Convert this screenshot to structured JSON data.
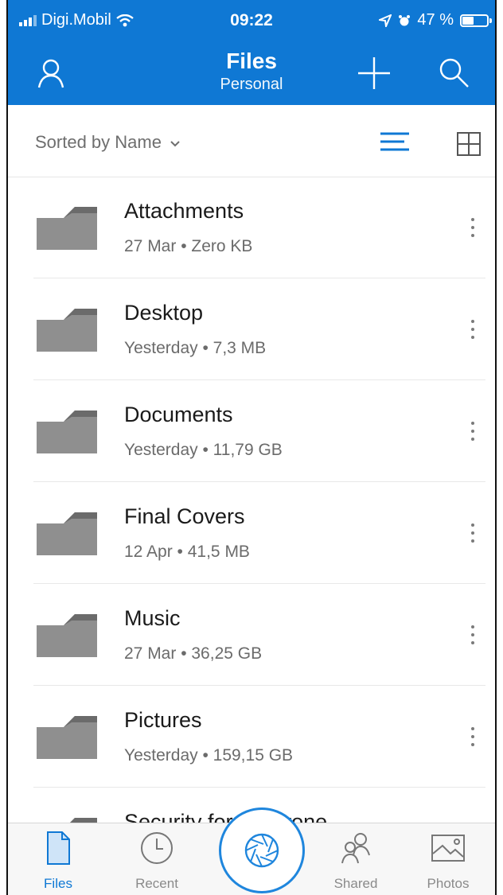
{
  "status_bar": {
    "carrier": "Digi.Mobil",
    "time": "09:22",
    "battery": "47 %"
  },
  "header": {
    "title": "Files",
    "subtitle": "Personal"
  },
  "sort": {
    "label": "Sorted by Name"
  },
  "items": [
    {
      "name": "Attachments",
      "meta": "27 Mar • Zero KB"
    },
    {
      "name": "Desktop",
      "meta": "Yesterday • 7,3 MB"
    },
    {
      "name": "Documents",
      "meta": "Yesterday • 11,79 GB"
    },
    {
      "name": "Final Covers",
      "meta": "12 Apr • 41,5 MB"
    },
    {
      "name": "Music",
      "meta": "27 Mar • 36,25 GB"
    },
    {
      "name": "Pictures",
      "meta": "Yesterday • 159,15 GB"
    },
    {
      "name": "Security for everyone",
      "meta": ""
    }
  ],
  "tabs": {
    "files": "Files",
    "recent": "Recent",
    "shared": "Shared",
    "photos": "Photos"
  },
  "colors": {
    "accent": "#0f78d4",
    "folder": "#8f8f8f"
  }
}
